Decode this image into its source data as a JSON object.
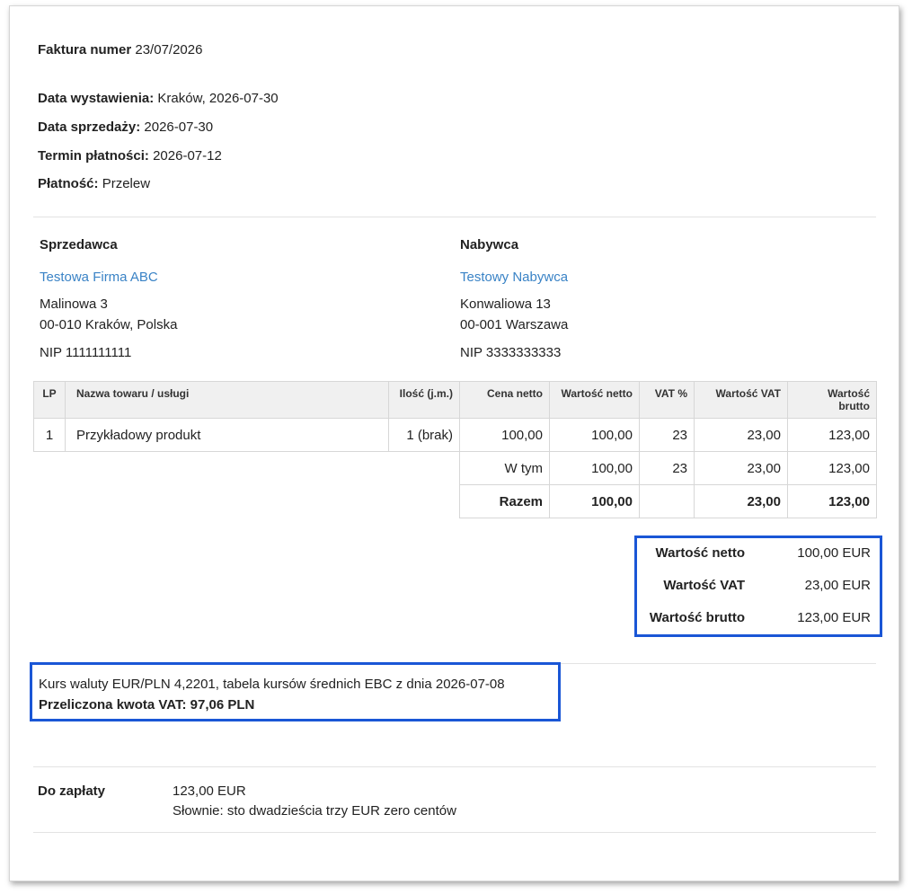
{
  "invoice": {
    "number_label": "Faktura numer",
    "number": "23/07/2026",
    "issue_date_label": "Data wystawienia:",
    "issue_date": "Kraków, 2026-07-30",
    "sale_date_label": "Data sprzedaży:",
    "sale_date": "2026-07-30",
    "due_date_label": "Termin płatności:",
    "due_date": "2026-07-12",
    "payment_label": "Płatność:",
    "payment": "Przelew"
  },
  "seller": {
    "title": "Sprzedawca",
    "name": "Testowa Firma ABC",
    "address1": "Malinowa 3",
    "address2": "00-010 Kraków, Polska",
    "nip": "NIP 1111111111"
  },
  "buyer": {
    "title": "Nabywca",
    "name": "Testowy Nabywca",
    "address1": "Konwaliowa 13",
    "address2": "00-001 Warszawa",
    "nip": "NIP 3333333333"
  },
  "table": {
    "headers": {
      "lp": "LP",
      "name": "Nazwa towaru / usługi",
      "qty": "Ilość (j.m.)",
      "net_price": "Cena netto",
      "net_value": "Wartość netto",
      "vat_rate": "VAT %",
      "vat_value": "Wartość VAT",
      "gross_value": "Wartość brutto"
    },
    "rows": [
      {
        "lp": "1",
        "name": "Przykładowy produkt",
        "qty": "1 (brak)",
        "net_price": "100,00",
        "net_value": "100,00",
        "vat_rate": "23",
        "vat_value": "23,00",
        "gross_value": "123,00"
      }
    ],
    "subtotal": {
      "label": "W tym",
      "net_value": "100,00",
      "vat_rate": "23",
      "vat_value": "23,00",
      "gross_value": "123,00"
    },
    "total": {
      "label": "Razem",
      "net_value": "100,00",
      "vat_value": "23,00",
      "gross_value": "123,00"
    }
  },
  "summary": {
    "net_label": "Wartość netto",
    "net": "100,00 EUR",
    "vat_label": "Wartość VAT",
    "vat": "23,00 EUR",
    "gross_label": "Wartość brutto",
    "gross": "123,00 EUR"
  },
  "exchange": {
    "rate_text": "Kurs waluty EUR/PLN 4,2201, tabela kursów średnich EBC z dnia 2026-07-08",
    "converted_vat": "Przeliczona kwota VAT: 97,06 PLN"
  },
  "payment_due": {
    "label": "Do zapłaty",
    "amount": "123,00 EUR",
    "in_words": "Słownie: sto dwadzieścia trzy EUR zero centów"
  }
}
